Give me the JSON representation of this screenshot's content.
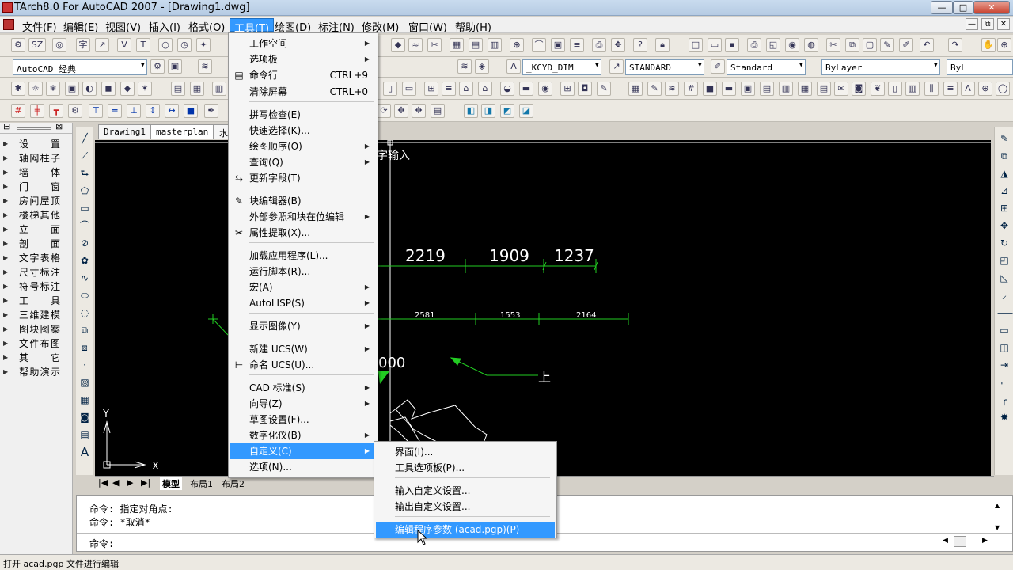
{
  "window": {
    "title": "TArch8.0 For AutoCAD 2007 - [Drawing1.dwg]",
    "btn_min": "—",
    "btn_max": "□",
    "btn_close": "✕"
  },
  "menubar": {
    "items": [
      "文件(F)",
      "编辑(E)",
      "视图(V)",
      "插入(I)",
      "格式(O)",
      "工具(T)",
      "绘图(D)",
      "标注(N)",
      "修改(M)",
      "窗口(W)",
      "帮助(H)"
    ],
    "mdi": [
      "—",
      "⧉",
      "✕"
    ]
  },
  "toolbar": {
    "sz_label": "SZ",
    "workspace": "AutoCAD 经典",
    "dimstyle": "_KCYD_DIM",
    "textstyle": "STANDARD",
    "tablestyle": "Standard",
    "layer": "ByLayer",
    "linetype": "ByL"
  },
  "left_panel": {
    "items": [
      "设　置",
      "轴网柱子",
      "墙　体",
      "门　窗",
      "房间屋顶",
      "楼梯其他",
      "立　面",
      "剖　面",
      "文字表格",
      "尺寸标注",
      "符号标注",
      "工　具",
      "三维建模",
      "图块图案",
      "文件布图",
      "其　它",
      "帮助演示"
    ]
  },
  "doc_tabs": [
    "Drawing1",
    "masterplan",
    "水"
  ],
  "canvas": {
    "text_input": "字输入",
    "dims_top": [
      "2219",
      "1909",
      "1237"
    ],
    "dims_small": [
      "2581",
      "1553",
      "2164"
    ],
    "elev": "000",
    "label_up": "上",
    "ucs_x": "X",
    "ucs_y": "Y"
  },
  "layout_tabs": [
    "模型",
    "布局1",
    "布局2"
  ],
  "tools_menu": {
    "items": [
      {
        "label": "工作空间",
        "sub": true
      },
      {
        "label": "选项板",
        "sub": true
      },
      {
        "label": "命令行",
        "shortcut": "CTRL+9",
        "icon": "command-line-icon"
      },
      {
        "label": "清除屏幕",
        "shortcut": "CTRL+0"
      },
      {
        "label": "拼写检查(E)"
      },
      {
        "label": "快速选择(K)..."
      },
      {
        "label": "绘图顺序(O)",
        "sub": true
      },
      {
        "label": "查询(Q)",
        "sub": true
      },
      {
        "label": "更新字段(T)",
        "icon": "update-field-icon"
      },
      {
        "label": "块编辑器(B)",
        "icon": "block-editor-icon"
      },
      {
        "label": "外部参照和块在位编辑",
        "sub": true
      },
      {
        "label": "属性提取(X)...",
        "icon": "attribute-extract-icon"
      },
      {
        "label": "加载应用程序(L)..."
      },
      {
        "label": "运行脚本(R)..."
      },
      {
        "label": "宏(A)",
        "sub": true
      },
      {
        "label": "AutoLISP(S)",
        "sub": true
      },
      {
        "label": "显示图像(Y)",
        "sub": true
      },
      {
        "label": "新建 UCS(W)",
        "sub": true
      },
      {
        "label": "命名 UCS(U)...",
        "icon": "named-ucs-icon"
      },
      {
        "label": "CAD 标准(S)",
        "sub": true
      },
      {
        "label": "向导(Z)",
        "sub": true
      },
      {
        "label": "草图设置(F)..."
      },
      {
        "label": "数字化仪(B)",
        "sub": true
      },
      {
        "label": "自定义(C)",
        "sub": true,
        "highlighted": true
      },
      {
        "label": "选项(N)..."
      }
    ]
  },
  "customize_menu": {
    "items": [
      "界面(I)...",
      "工具选项板(P)...",
      "输入自定义设置...",
      "输出自定义设置...",
      "编辑程序参数 (acad.pgp)(P)"
    ]
  },
  "command": {
    "lines": [
      "命令: 指定对角点:",
      "命令: *取消*"
    ],
    "prompt": "命令:"
  },
  "status": {
    "text": "打开 acad.pgp 文件进行编辑"
  }
}
